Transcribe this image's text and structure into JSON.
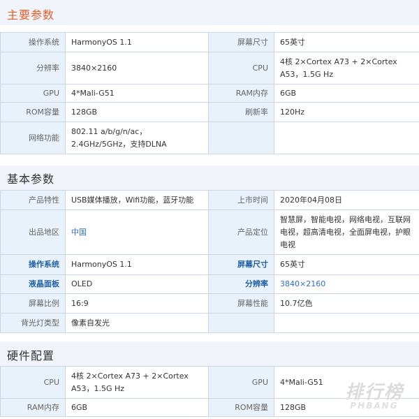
{
  "sections": {
    "main": {
      "title": "主要参数",
      "rows": [
        {
          "k1": "操作系统",
          "v1": "HarmonyOS 1.1",
          "k2": "屏幕尺寸",
          "v2": "65英寸"
        },
        {
          "k1": "分辨率",
          "v1": "3840×2160",
          "k2": "CPU",
          "v2": "4核 2×Cortex A73 + 2×Cortex A53，1.5G Hz"
        },
        {
          "k1": "GPU",
          "v1": "4*Mali-G51",
          "k2": "RAM内存",
          "v2": "6GB"
        },
        {
          "k1": "ROM容量",
          "v1": "128GB",
          "k2": "刷新率",
          "v2": "120Hz"
        },
        {
          "k1": "网络功能",
          "v1": "802.11 a/b/g/n/ac，2.4GHz/5GHz，支持DLNA",
          "k2": "",
          "v2": ""
        }
      ]
    },
    "basic": {
      "title": "基本参数",
      "rows": [
        {
          "k1": "产品特性",
          "v1": "USB媒体播放，Wifi功能，蓝牙功能",
          "k2": "上市时间",
          "v2": "2020年04月08日"
        },
        {
          "k1": "出品地区",
          "v1": "中国",
          "k2": "产品定位",
          "v2": "智慧屏，智能电视，网络电视，互联网电视，超高清电视，全面屏电视，护眼电视"
        },
        {
          "k1": "操作系统",
          "v1": "HarmonyOS 1.1",
          "k2": "屏幕尺寸",
          "v2": "65英寸"
        },
        {
          "k1": "液晶面板",
          "v1": "OLED",
          "k2": "分辨率",
          "v2": "3840×2160"
        },
        {
          "k1": "屏幕比例",
          "v1": "16:9",
          "k2": "屏幕性能",
          "v2": "10.7亿色"
        },
        {
          "k1": "背光灯类型",
          "v1": "像素自发光",
          "k2": "",
          "v2": ""
        }
      ]
    },
    "hardware": {
      "title": "硬件配置",
      "rows": [
        {
          "k1": "CPU",
          "v1": "4核 2×Cortex A73 + 2×Cortex A53，1.5G Hz",
          "k2": "GPU",
          "v2": "4*Mali-G51"
        },
        {
          "k1": "RAM内存",
          "v1": "6GB",
          "k2": "ROM容量",
          "v2": "128GB"
        }
      ]
    }
  },
  "watermark": {
    "cn": "排行榜",
    "en": "PHBANG"
  },
  "colors": {
    "accent_title": "#e65c27",
    "label_bg": "#e9f1fb",
    "border": "#c9d6e8",
    "link": "#2a6fc9",
    "bold_label": "#1f5fa8"
  }
}
